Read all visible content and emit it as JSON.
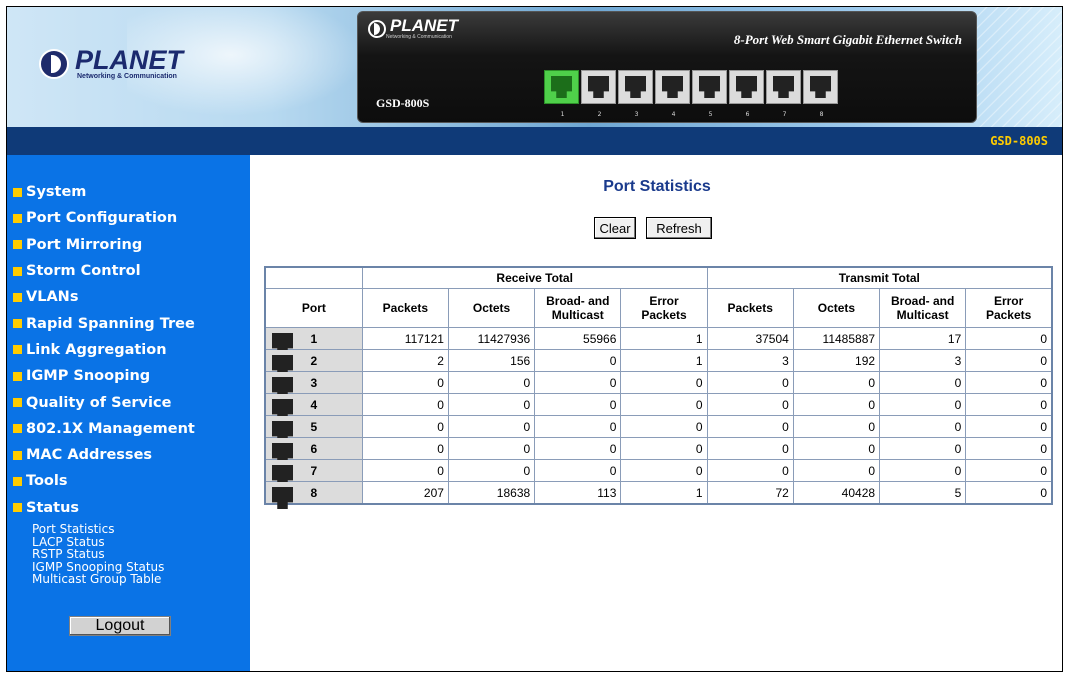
{
  "header": {
    "brand": "PLANET",
    "brand_sub": "Networking & Communication",
    "device_title": "8-Port Web Smart Gigabit Ethernet Switch",
    "device_model": "GSD-800S",
    "port_numbers": [
      "1",
      "2",
      "3",
      "4",
      "5",
      "6",
      "7",
      "8"
    ],
    "active_ports": [
      1
    ]
  },
  "topbar": {
    "model": "GSD-800S"
  },
  "sidebar": {
    "items": [
      {
        "label": "System"
      },
      {
        "label": "Port Configuration"
      },
      {
        "label": "Port Mirroring"
      },
      {
        "label": "Storm Control"
      },
      {
        "label": "VLANs"
      },
      {
        "label": "Rapid Spanning Tree"
      },
      {
        "label": "Link Aggregation"
      },
      {
        "label": "IGMP Snooping"
      },
      {
        "label": "Quality of Service"
      },
      {
        "label": "802.1X Management"
      },
      {
        "label": "MAC Addresses"
      },
      {
        "label": "Tools"
      },
      {
        "label": "Status"
      }
    ],
    "status_sub": [
      {
        "label": "Port Statistics"
      },
      {
        "label": "LACP Status"
      },
      {
        "label": "RSTP Status"
      },
      {
        "label": "IGMP Snooping Status"
      },
      {
        "label": "Multicast Group Table"
      }
    ],
    "logout_label": "Logout"
  },
  "main": {
    "title": "Port Statistics",
    "clear_label": "Clear",
    "refresh_label": "Refresh",
    "table": {
      "group_headers": {
        "receive": "Receive Total",
        "transmit": "Transmit Total"
      },
      "columns": {
        "port": "Port",
        "rx_packets": "Packets",
        "rx_octets": "Octets",
        "rx_bcast_1": "Broad- and",
        "rx_bcast_2": "Multicast",
        "rx_err_1": "Error",
        "rx_err_2": "Packets",
        "tx_packets": "Packets",
        "tx_octets": "Octets",
        "tx_bcast_1": "Broad- and",
        "tx_bcast_2": "Multicast",
        "tx_err_1": "Error",
        "tx_err_2": "Packets"
      },
      "rows": [
        {
          "port": "1",
          "rx_packets": "117121",
          "rx_octets": "11427936",
          "rx_bcast": "55966",
          "rx_err": "1",
          "tx_packets": "37504",
          "tx_octets": "11485887",
          "tx_bcast": "17",
          "tx_err": "0"
        },
        {
          "port": "2",
          "rx_packets": "2",
          "rx_octets": "156",
          "rx_bcast": "0",
          "rx_err": "1",
          "tx_packets": "3",
          "tx_octets": "192",
          "tx_bcast": "3",
          "tx_err": "0"
        },
        {
          "port": "3",
          "rx_packets": "0",
          "rx_octets": "0",
          "rx_bcast": "0",
          "rx_err": "0",
          "tx_packets": "0",
          "tx_octets": "0",
          "tx_bcast": "0",
          "tx_err": "0"
        },
        {
          "port": "4",
          "rx_packets": "0",
          "rx_octets": "0",
          "rx_bcast": "0",
          "rx_err": "0",
          "tx_packets": "0",
          "tx_octets": "0",
          "tx_bcast": "0",
          "tx_err": "0"
        },
        {
          "port": "5",
          "rx_packets": "0",
          "rx_octets": "0",
          "rx_bcast": "0",
          "rx_err": "0",
          "tx_packets": "0",
          "tx_octets": "0",
          "tx_bcast": "0",
          "tx_err": "0"
        },
        {
          "port": "6",
          "rx_packets": "0",
          "rx_octets": "0",
          "rx_bcast": "0",
          "rx_err": "0",
          "tx_packets": "0",
          "tx_octets": "0",
          "tx_bcast": "0",
          "tx_err": "0"
        },
        {
          "port": "7",
          "rx_packets": "0",
          "rx_octets": "0",
          "rx_bcast": "0",
          "rx_err": "0",
          "tx_packets": "0",
          "tx_octets": "0",
          "tx_bcast": "0",
          "tx_err": "0"
        },
        {
          "port": "8",
          "rx_packets": "207",
          "rx_octets": "18638",
          "rx_bcast": "113",
          "rx_err": "1",
          "tx_packets": "72",
          "tx_octets": "40428",
          "tx_bcast": "5",
          "tx_err": "0"
        }
      ]
    }
  },
  "colors": {
    "sidebar": "#0a73e6",
    "topbar": "#0f3a78",
    "bullet": "#ffcc00",
    "title": "#1a3a8c",
    "model_tag": "#ffcc00"
  }
}
